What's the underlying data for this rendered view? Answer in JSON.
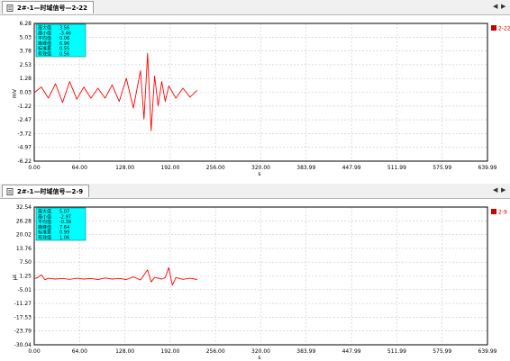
{
  "windows": [
    {
      "tab_title": "2#-1—时域信号—2-22",
      "y_unit": "mV",
      "x_unit": "s",
      "legend_label": "2-22",
      "stats": [
        {
          "label": "最大值",
          "value": "3.56"
        },
        {
          "label": "最小值",
          "value": "-3.46"
        },
        {
          "label": "平均值",
          "value": "0.06"
        },
        {
          "label": "峰峰值",
          "value": "6.96"
        },
        {
          "label": "标准差",
          "value": "0.55"
        },
        {
          "label": "有效值",
          "value": "0.56"
        }
      ]
    },
    {
      "tab_title": "2#-1—时域信号—2-9",
      "y_unit": "με",
      "x_unit": "s",
      "legend_label": "2-9",
      "stats": [
        {
          "label": "最大值",
          "value": "5.07"
        },
        {
          "label": "最小值",
          "value": "-2.97"
        },
        {
          "label": "平均值",
          "value": "-0.39"
        },
        {
          "label": "峰峰值",
          "value": "7.64"
        },
        {
          "label": "标准差",
          "value": "0.99"
        },
        {
          "label": "有效值",
          "value": "1.06"
        }
      ]
    }
  ],
  "nav": {
    "prev": "◀",
    "next": "▶"
  },
  "colors": {
    "signal": "#ff0000",
    "stats_bg": "#00ffff",
    "grid": "#c8c8c8",
    "legend_icon_bg": "#cc0000"
  },
  "chart_data": [
    {
      "type": "line",
      "title": "",
      "xlabel": "s",
      "ylabel": "mV",
      "xlim": [
        0,
        639.99
      ],
      "ylim": [
        -6.22,
        6.28
      ],
      "x_ticks": [
        "0.00",
        "64.00",
        "128.00",
        "192.00",
        "256.00",
        "320.00",
        "383.99",
        "447.99",
        "511.99",
        "575.99",
        "639.99"
      ],
      "y_ticks": [
        "6.28",
        "5.03",
        "3.78",
        "2.53",
        "1.28",
        "0.03",
        "-1.22",
        "-2.47",
        "-3.72",
        "-4.97",
        "-6.22"
      ],
      "grid": true,
      "series": [
        {
          "name": "2-22",
          "color": "#ff0000",
          "x": [
            0,
            10,
            20,
            30,
            40,
            50,
            60,
            70,
            80,
            90,
            100,
            110,
            120,
            130,
            140,
            150,
            155,
            160,
            165,
            170,
            175,
            180,
            185,
            190,
            200,
            210,
            220,
            230
          ],
          "y": [
            0.0,
            0.5,
            -0.5,
            0.8,
            -0.9,
            1.0,
            -0.6,
            0.5,
            -0.5,
            0.4,
            -0.5,
            0.7,
            -0.8,
            1.3,
            -1.4,
            2.0,
            -2.4,
            3.56,
            -3.46,
            1.5,
            -1.2,
            1.0,
            -0.8,
            0.6,
            -0.5,
            0.4,
            -0.4,
            0.2
          ]
        }
      ]
    },
    {
      "type": "line",
      "title": "",
      "xlabel": "s",
      "ylabel": "με",
      "xlim": [
        0,
        639.99
      ],
      "ylim": [
        -30.04,
        32.54
      ],
      "x_ticks": [
        "0.00",
        "64.00",
        "128.00",
        "192.00",
        "256.00",
        "320.00",
        "383.99",
        "447.99",
        "511.99",
        "575.99",
        "639.99"
      ],
      "y_ticks": [
        "32.54",
        "26.28",
        "20.02",
        "13.76",
        "7.50",
        "1.25",
        "-5.01",
        "-11.27",
        "-17.53",
        "-23.79",
        "-30.04"
      ],
      "grid": true,
      "series": [
        {
          "name": "2-9",
          "color": "#ff0000",
          "x": [
            0,
            5,
            10,
            15,
            20,
            30,
            40,
            50,
            60,
            70,
            80,
            90,
            100,
            110,
            120,
            130,
            140,
            150,
            160,
            165,
            170,
            180,
            185,
            190,
            195,
            200,
            210,
            220,
            230
          ],
          "y": [
            0.0,
            0.5,
            1.8,
            -0.5,
            0.2,
            -0.2,
            0.1,
            -0.3,
            0.2,
            -0.2,
            0.1,
            -0.4,
            0.3,
            -0.2,
            0.1,
            -0.4,
            0.8,
            -0.6,
            4.0,
            -1.5,
            0.6,
            -0.2,
            0.5,
            5.07,
            -2.97,
            0.5,
            -0.3,
            0.2,
            -0.4
          ]
        }
      ]
    }
  ]
}
